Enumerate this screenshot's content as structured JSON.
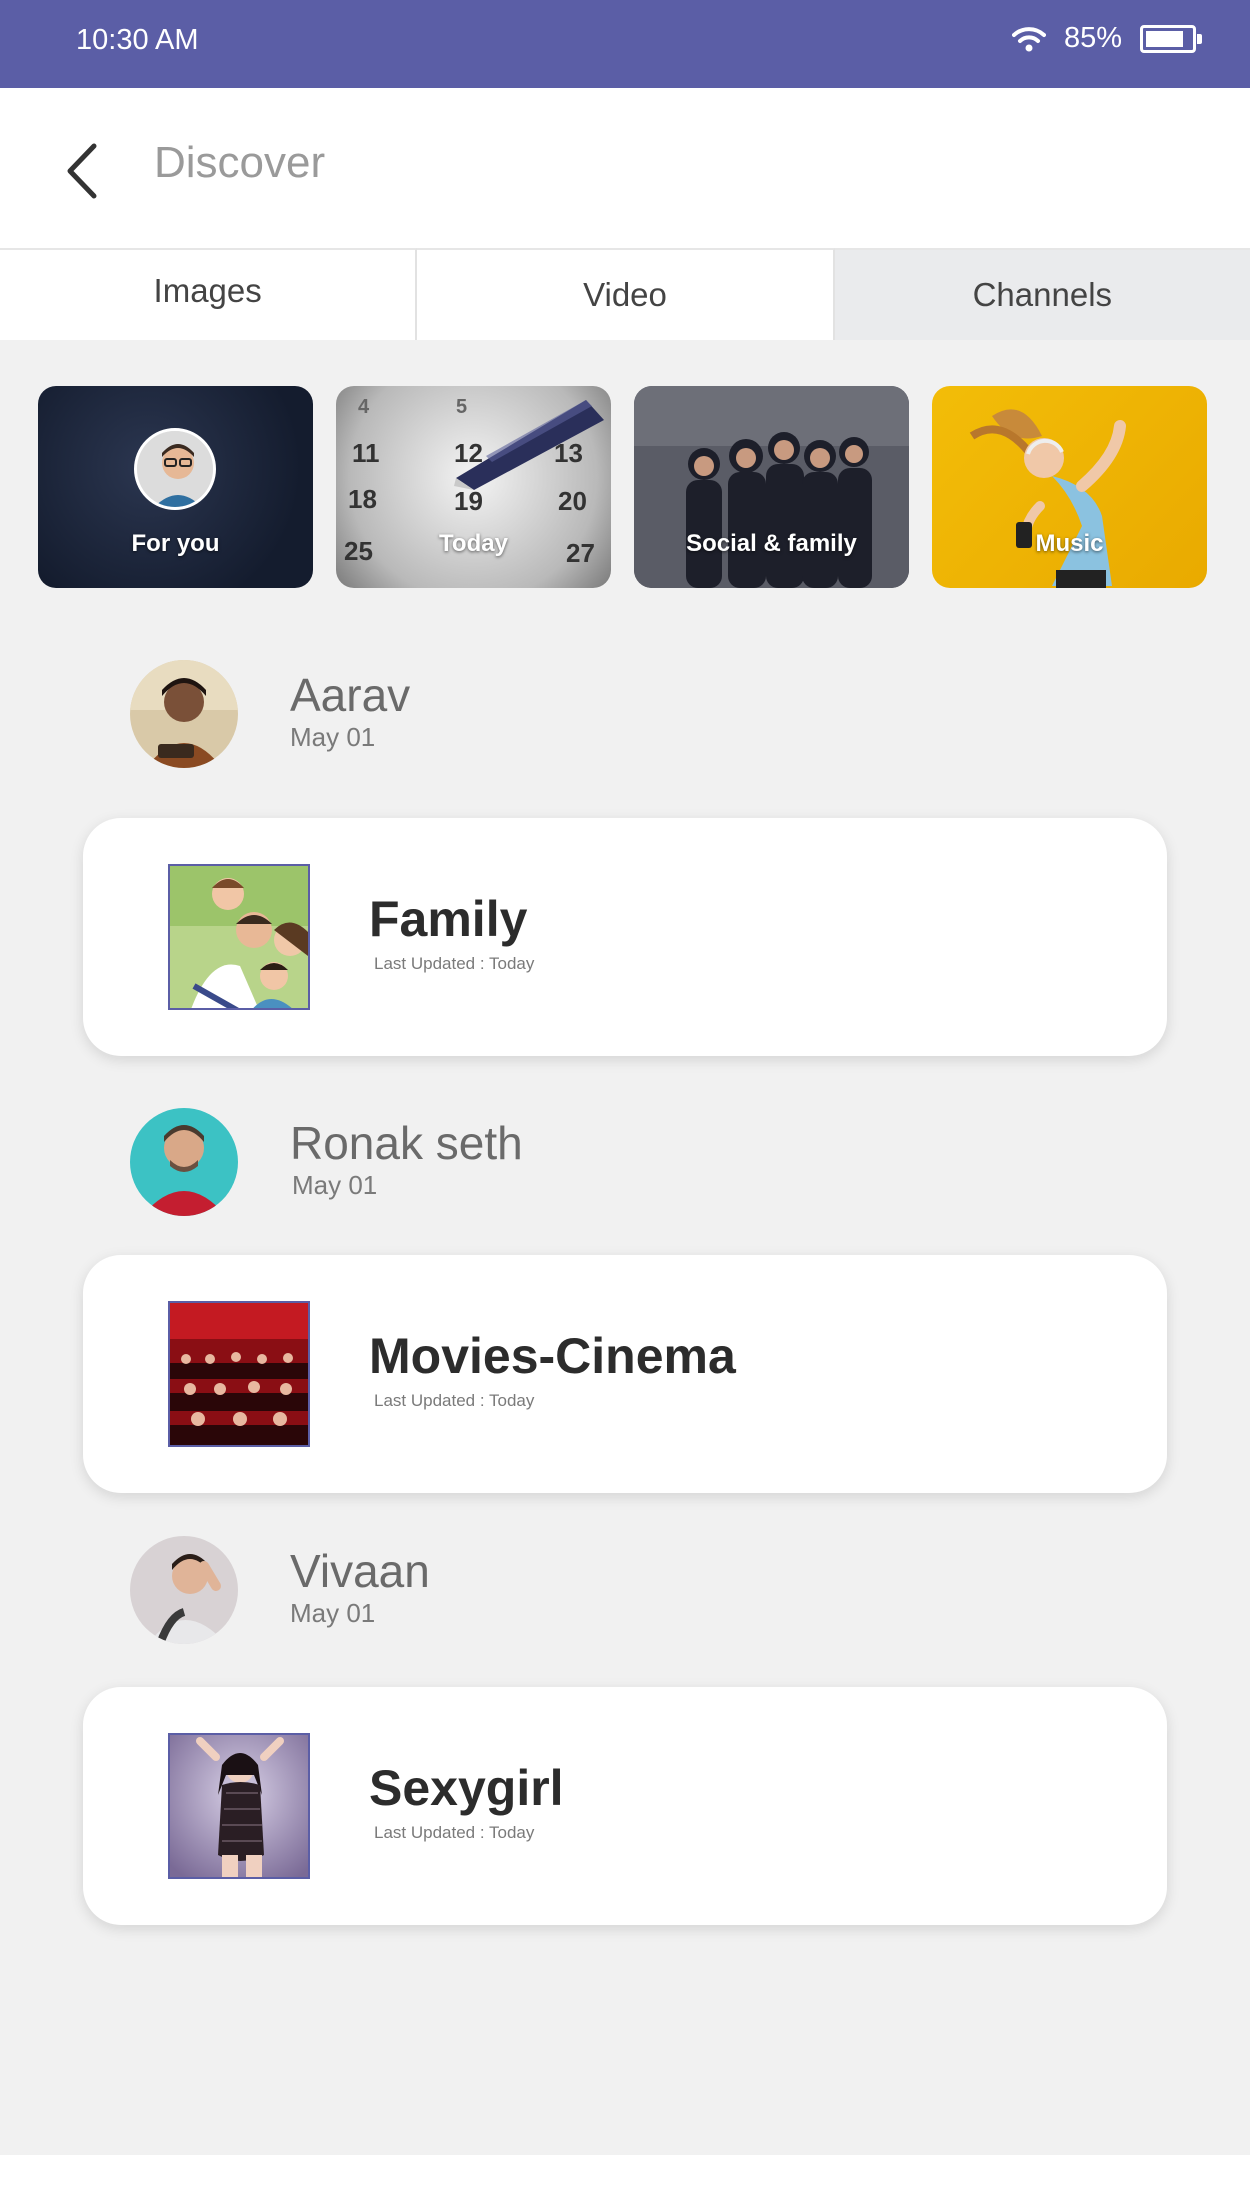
{
  "status_bar": {
    "time": "10:30 AM",
    "battery_text": "85%",
    "battery_level": 0.85
  },
  "header": {
    "title": "Discover"
  },
  "tabs": [
    {
      "label": "Images"
    },
    {
      "label": "Video"
    },
    {
      "label": "Channels",
      "active": true
    }
  ],
  "categories": [
    {
      "label": "For you"
    },
    {
      "label": "Today"
    },
    {
      "label": "Social & family"
    },
    {
      "label": "Music"
    }
  ],
  "feed": [
    {
      "user": "Aarav",
      "date": "May 01",
      "card_title": "Family",
      "card_subtitle": "Last Updated : Today"
    },
    {
      "user": "Ronak seth",
      "date": "May 01",
      "card_title": "Movies-Cinema",
      "card_subtitle": "Last Updated : Today"
    },
    {
      "user": "Vivaan",
      "date": "May 01",
      "card_title": "Sexygirl",
      "card_subtitle": "Last Updated : Today"
    }
  ],
  "colors": {
    "accent": "#5b5ea6",
    "background": "#f1f1f1"
  }
}
